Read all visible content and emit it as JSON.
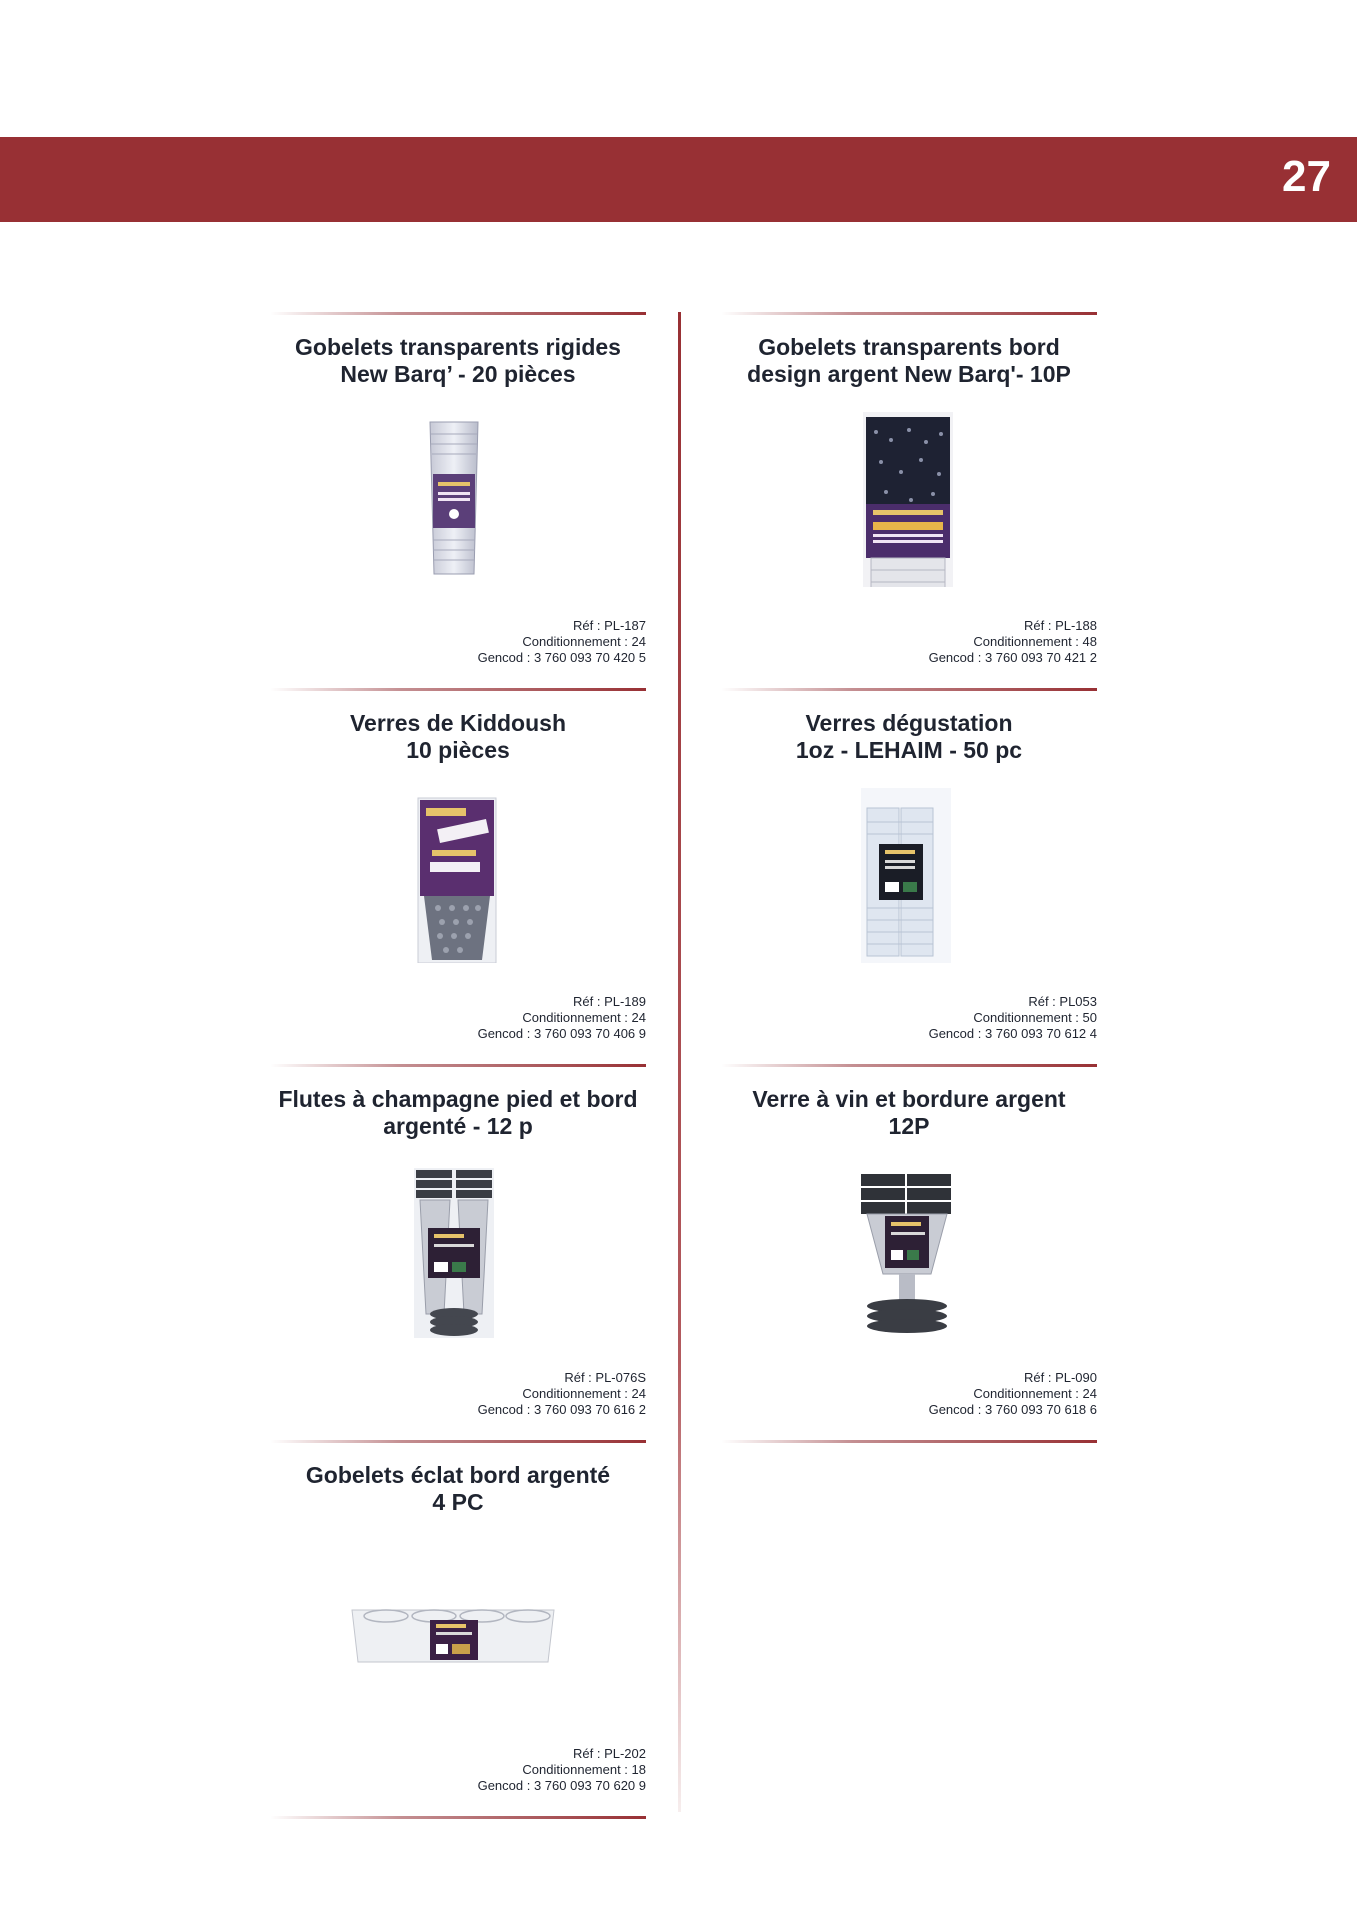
{
  "header": {
    "page_number": "27",
    "band_color": "#983034"
  },
  "products": [
    {
      "id": "p1",
      "title_lines": [
        "Gobelets transparents rigides",
        "New Barq’ - 20 pièces"
      ],
      "ref": "Réf : PL-187",
      "packaging": "Conditionnement : 24",
      "gencod": "Gencod : 3 760 093 70 420 5",
      "image_icon": "clear-cup-stack"
    },
    {
      "id": "p2",
      "title_lines": [
        "Gobelets transparents bord",
        "design argent  New Barq'- 10P"
      ],
      "ref": "Réf : PL-188",
      "packaging": "Conditionnement : 48",
      "gencod": "Gencod : 3 760 093 70 421 2",
      "image_icon": "dark-cup-tube"
    },
    {
      "id": "p3",
      "title_lines": [
        "Verres de Kiddoush",
        "10 pièces"
      ],
      "ref": "Réf : PL-189",
      "packaging": "Conditionnement : 24",
      "gencod": "Gencod : 3 760 093 70 406 9",
      "image_icon": "kiddoush-glass-pack"
    },
    {
      "id": "p4",
      "title_lines": [
        "Verres dégustation",
        "1oz - LEHAIM - 50 pc"
      ],
      "ref": "Réf : PL053",
      "packaging": "Conditionnement : 50",
      "gencod": "Gencod : 3 760 093 70 612 4",
      "image_icon": "shot-glass-stack"
    },
    {
      "id": "p5",
      "title_lines": [
        "Flutes à champagne pied et bord",
        "argenté - 12 p"
      ],
      "ref": "Réf : PL-076S",
      "packaging": "Conditionnement : 24",
      "gencod": "Gencod : 3 760 093 70 616 2",
      "image_icon": "champagne-flute-pack"
    },
    {
      "id": "p6",
      "title_lines": [
        "Verre à vin et bordure argent",
        "12P"
      ],
      "ref": "Réf : PL-090",
      "packaging": "Conditionnement : 24",
      "gencod": "Gencod : 3 760 093 70 618 6",
      "image_icon": "wine-glass-pack"
    },
    {
      "id": "p7",
      "title_lines": [
        "Gobelets éclat bord argenté",
        "4 PC"
      ],
      "ref": "Réf : PL-202",
      "packaging": "Conditionnement : 18",
      "gencod": "Gencod : 3 760 093 70 620 9",
      "image_icon": "tumbler-box"
    }
  ]
}
